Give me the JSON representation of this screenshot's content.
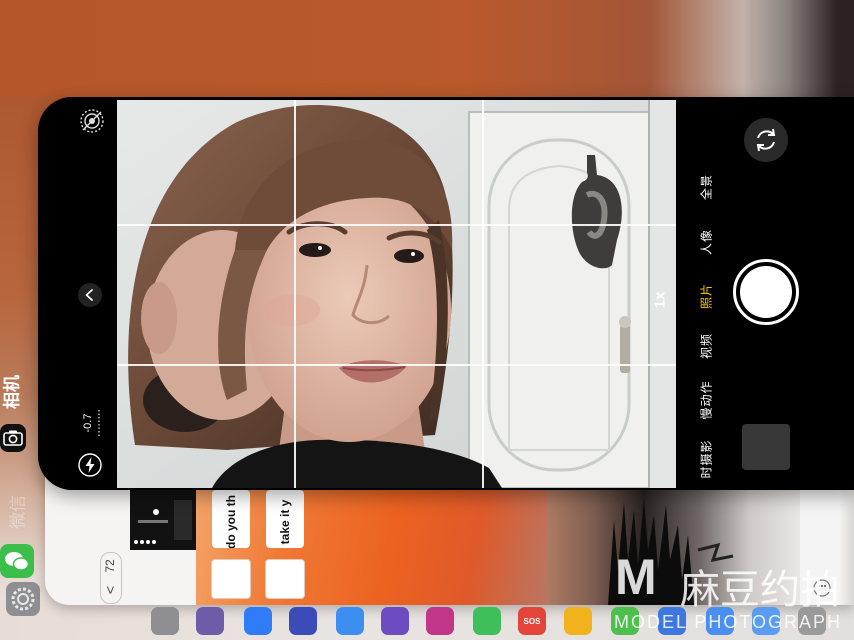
{
  "app_switcher": {
    "camera_label": "相机",
    "wechat_label": "微信"
  },
  "camera": {
    "exposure_value": "-0.7",
    "zoom_level": "1x",
    "modes": [
      "全景",
      "人像",
      "照片",
      "视频",
      "慢动作",
      "时摄影"
    ],
    "active_mode_index": 2,
    "active_mode_color": "#f5c518",
    "grid": true,
    "icons": {
      "live_photo": "live-photo-icon",
      "collapse": "chevron-icon",
      "flash": "flash-icon",
      "switch_camera": "switch-camera-icon"
    }
  },
  "wechat": {
    "back_glyph": "<",
    "unread_count": "72",
    "messages": [
      "do you th",
      "take it y"
    ]
  },
  "dock": {
    "apps": [
      {
        "icon": "settings-icon",
        "color": "#8e8e93"
      },
      {
        "icon": "app-icon",
        "color": "#6e5ca8"
      },
      {
        "icon": "app-store-icon",
        "color": "#2f7cf6"
      },
      {
        "icon": "calendar-icon",
        "color": "#3b4bb8"
      },
      {
        "icon": "browser-icon",
        "color": "#3c8ef0"
      },
      {
        "icon": "app-icon",
        "color": "#6d4cc2"
      },
      {
        "icon": "app-icon",
        "color": "#c2368a"
      },
      {
        "icon": "messages-icon",
        "color": "#3fbf5a"
      },
      {
        "icon": "sos-icon",
        "color": "#e4453a",
        "label": "SOS"
      },
      {
        "icon": "sunflower-icon",
        "color": "#f2b21c"
      },
      {
        "icon": "app-icon",
        "color": "#4cbf4c"
      },
      {
        "icon": "app-icon",
        "color": "#3c78e0"
      },
      {
        "icon": "app-icon",
        "color": "#4a8ef0"
      },
      {
        "icon": "app-icon",
        "color": "#5a9cf2"
      },
      {
        "icon": "app-icon",
        "color": "#9a9a9a"
      }
    ]
  },
  "watermark": {
    "logo": "M",
    "brand": "麻豆约拍",
    "tagline": "MODEL PHOTOGRAPH"
  }
}
